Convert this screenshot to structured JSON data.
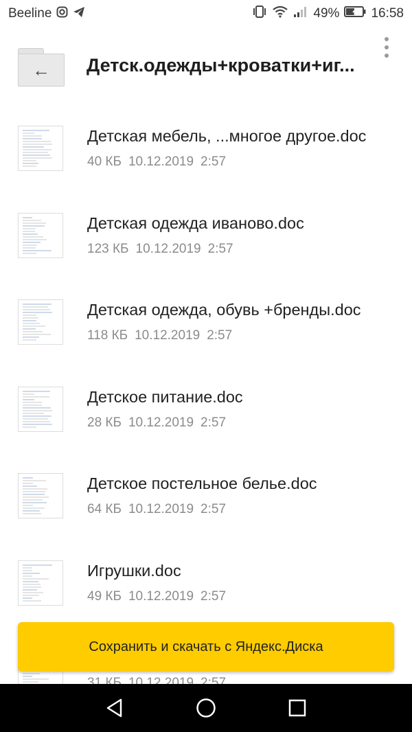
{
  "status_bar": {
    "carrier": "Beeline",
    "icons_left": [
      "instagram-icon",
      "telegram-icon"
    ],
    "icons_right": [
      "vibrate-icon",
      "wifi-icon",
      "signal-icon"
    ],
    "battery_percent": "49%",
    "time": "16:58"
  },
  "header": {
    "title": "Детск.одежды+кроватки+иг...",
    "back_icon": "←"
  },
  "files": [
    {
      "name": "Детская мебель, ...многое другое.doc",
      "size": "40 КБ",
      "date": "10.12.2019",
      "time": "2:57"
    },
    {
      "name": "Детская одежда иваново.doc",
      "size": "123 КБ",
      "date": "10.12.2019",
      "time": "2:57"
    },
    {
      "name": "Детская одежда, обувь +бренды.doc",
      "size": "118 КБ",
      "date": "10.12.2019",
      "time": "2:57"
    },
    {
      "name": "Детское питание.doc",
      "size": "28 КБ",
      "date": "10.12.2019",
      "time": "2:57"
    },
    {
      "name": "Детское постельное белье.doc",
      "size": "64 КБ",
      "date": "10.12.2019",
      "time": "2:57"
    },
    {
      "name": "Игрушки.doc",
      "size": "49 КБ",
      "date": "10.12.2019",
      "time": "2:57"
    },
    {
      "name": "",
      "size": "31 КБ",
      "date": "10.12.2019",
      "time": "2:57"
    }
  ],
  "save_button": {
    "label": "Сохранить и скачать с Яндекс.Диска"
  },
  "colors": {
    "accent": "#ffcc00",
    "meta_text": "#8b8b8b"
  }
}
